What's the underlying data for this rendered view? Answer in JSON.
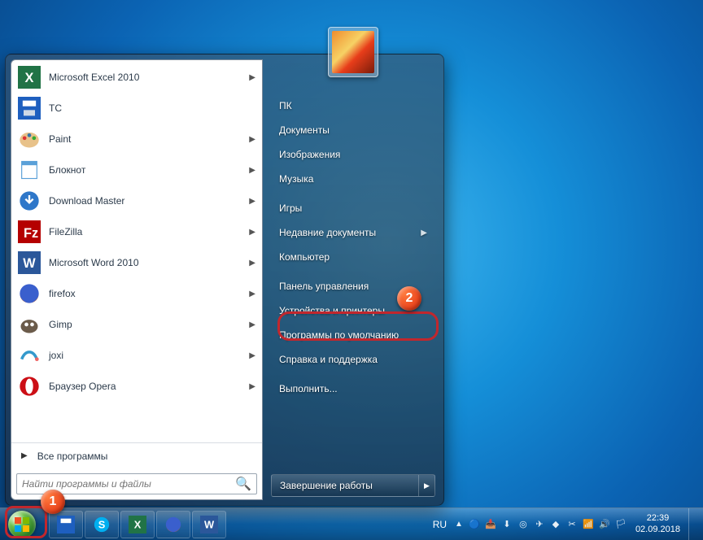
{
  "start_menu": {
    "programs": [
      {
        "label": "Microsoft Excel 2010",
        "icon": "excel",
        "has_sub": true
      },
      {
        "label": "TC",
        "icon": "save-blue",
        "has_sub": false
      },
      {
        "label": "Paint",
        "icon": "paint",
        "has_sub": true
      },
      {
        "label": "Блокнот",
        "icon": "notepad",
        "has_sub": true
      },
      {
        "label": "Download Master",
        "icon": "dm",
        "has_sub": true
      },
      {
        "label": "FileZilla",
        "icon": "filezilla",
        "has_sub": true
      },
      {
        "label": "Microsoft Word 2010",
        "icon": "word",
        "has_sub": true
      },
      {
        "label": "firefox",
        "icon": "firefox",
        "has_sub": true
      },
      {
        "label": "Gimp",
        "icon": "gimp",
        "has_sub": true
      },
      {
        "label": "joxi",
        "icon": "joxi",
        "has_sub": true
      },
      {
        "label": "Браузер Opera",
        "icon": "opera",
        "has_sub": true
      }
    ],
    "all_programs": "Все программы",
    "search_placeholder": "Найти программы и файлы",
    "right": [
      {
        "label": "ПК",
        "sub": false
      },
      {
        "label": "Документы",
        "sub": false
      },
      {
        "label": "Изображения",
        "sub": false
      },
      {
        "label": "Музыка",
        "sub": false
      },
      {
        "label": "Игры",
        "sub": false
      },
      {
        "label": "Недавние документы",
        "sub": true
      },
      {
        "label": "Компьютер",
        "sub": false
      },
      {
        "label": "Панель управления",
        "sub": false
      },
      {
        "label": "Устройства и принтеры",
        "sub": false
      },
      {
        "label": "Программы по умолчанию",
        "sub": false
      },
      {
        "label": "Справка и поддержка",
        "sub": false
      },
      {
        "label": "Выполнить...",
        "sub": false
      }
    ],
    "shutdown": "Завершение работы"
  },
  "tray": {
    "lang": "RU",
    "time": "22:39",
    "date": "02.09.2018"
  },
  "callouts": {
    "b1": "1",
    "b2": "2"
  }
}
